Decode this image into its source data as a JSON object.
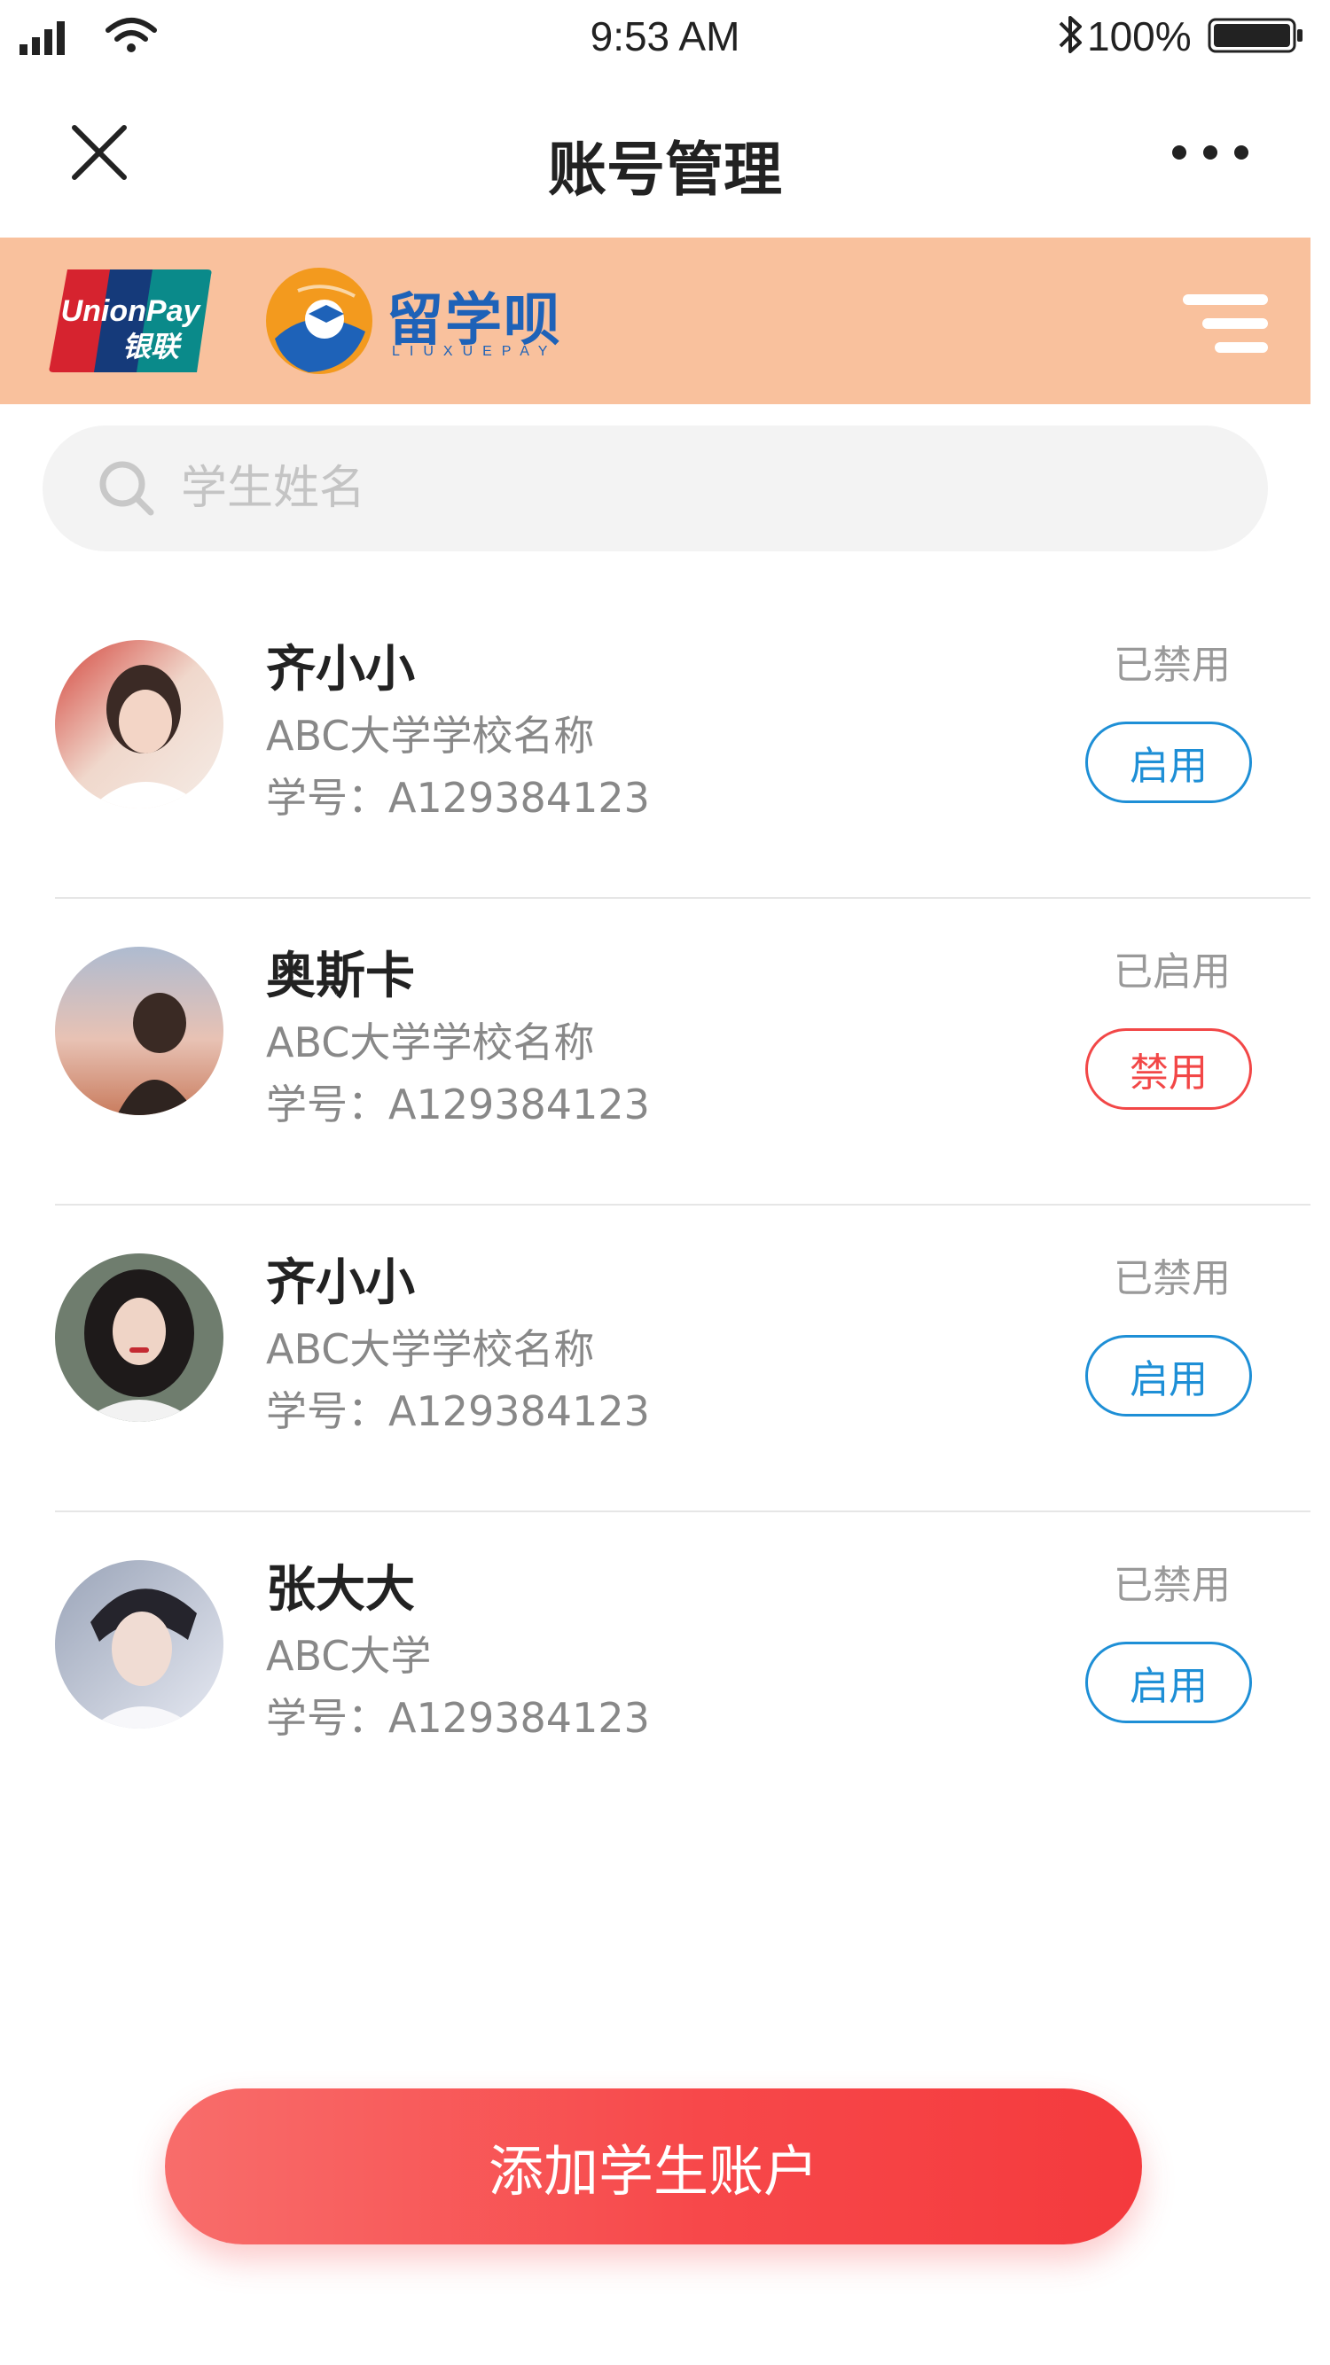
{
  "status_bar": {
    "time": "9:53 AM",
    "battery": "100%"
  },
  "nav": {
    "title": "账号管理"
  },
  "banner": {
    "unionpay_text": "UnionPay",
    "unionpay_cn": "银联",
    "brand_name": "留学呗",
    "brand_sub": "LIUXUEPAY"
  },
  "search": {
    "placeholder": "学生姓名",
    "value": ""
  },
  "students": [
    {
      "name": "齐小小",
      "school": "ABC大学学校名称",
      "id_label": "学号：A129384123",
      "status": "已禁用",
      "action": "启用",
      "action_type": "enable",
      "avatar_colors": [
        "#f0cfc4",
        "#7a5b4e"
      ]
    },
    {
      "name": "奥斯卡",
      "school": "ABC大学学校名称",
      "id_label": "学号：A129384123",
      "status": "已启用",
      "action": "禁用",
      "action_type": "disable",
      "avatar_colors": [
        "#b9c4d4",
        "#d9927a"
      ]
    },
    {
      "name": "齐小小",
      "school": "ABC大学学校名称",
      "id_label": "学号：A129384123",
      "status": "已禁用",
      "action": "启用",
      "action_type": "enable",
      "avatar_colors": [
        "#7e8a7c",
        "#2a2a2a"
      ]
    },
    {
      "name": "张大大",
      "school": "ABC大学",
      "id_label": "学号：A129384123",
      "status": "已禁用",
      "action": "启用",
      "action_type": "enable",
      "avatar_colors": [
        "#cfd6e6",
        "#2c2c35"
      ]
    }
  ],
  "add_button": {
    "label": "添加学生账户"
  },
  "colors": {
    "banner_bg": "#f9c19d",
    "enable_blue": "#1e8fd6",
    "disable_red": "#f24747",
    "add_button": "#f5474a"
  }
}
